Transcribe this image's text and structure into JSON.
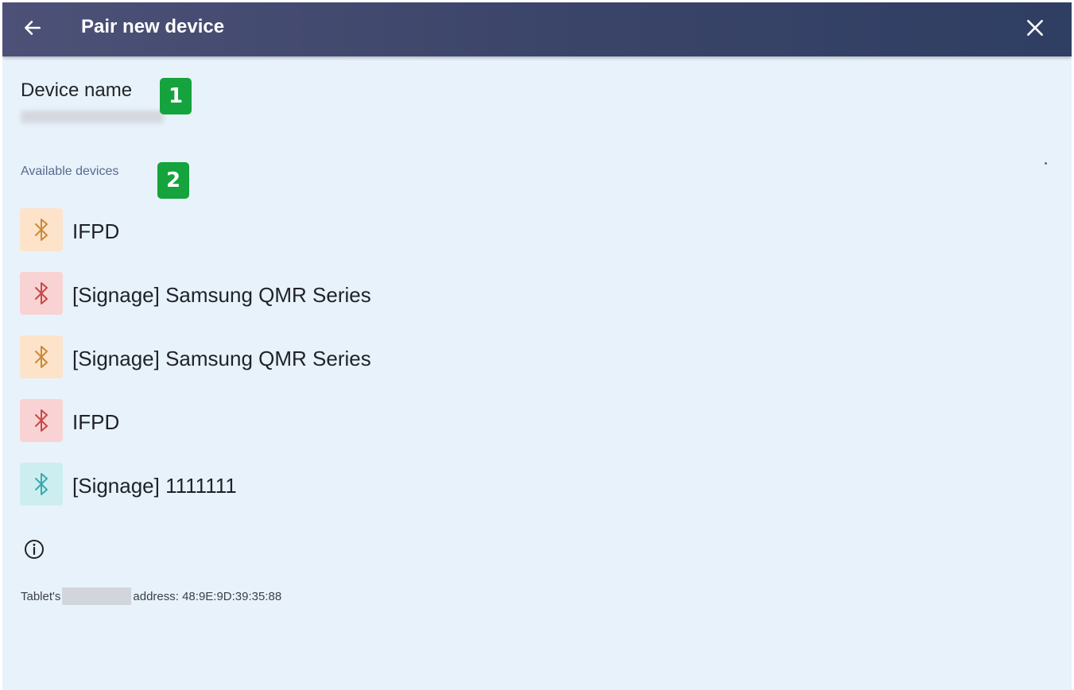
{
  "header": {
    "back_icon": "arrow-left-icon",
    "title": "Pair new device",
    "close_icon": "close-icon"
  },
  "device_name": {
    "label": "Device name"
  },
  "badges": [
    "1",
    "2"
  ],
  "available": {
    "label": "Available devices",
    "items": [
      {
        "name": "IFPD",
        "icon": "bluetooth-icon",
        "bg": "#fde3c9",
        "fg": "#c98a3a"
      },
      {
        "name": "[Signage] Samsung QMR Series",
        "icon": "bluetooth-icon",
        "bg": "#f9d3d3",
        "fg": "#c84848"
      },
      {
        "name": "[Signage] Samsung QMR Series",
        "icon": "bluetooth-icon",
        "bg": "#fde3c9",
        "fg": "#c98a3a"
      },
      {
        "name": "IFPD",
        "icon": "bluetooth-icon",
        "bg": "#f9d3d3",
        "fg": "#c84848"
      },
      {
        "name": "[Signage] 1111111",
        "icon": "bluetooth-icon",
        "bg": "#cdeef0",
        "fg": "#3aa9ad"
      }
    ]
  },
  "footer": {
    "info_icon": "info-icon",
    "prefix": "Tablet's",
    "suffix": "address: 48:9E:9D:39:35:88"
  },
  "colors": {
    "header_bg": "#3a4468",
    "page_bg": "#e8f2fb",
    "badge_bg": "#14a33c"
  }
}
